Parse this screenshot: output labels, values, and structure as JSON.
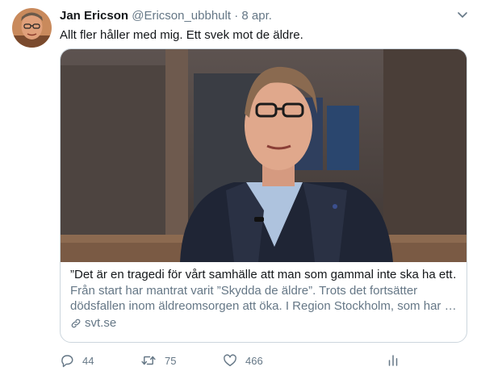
{
  "tweet": {
    "author_name": "Jan Ericson",
    "author_handle": "@Ericson_ubbhult",
    "separator": "·",
    "date": "8 apr.",
    "text": "Allt fler håller med mig. Ett svek mot de äldre.",
    "menu_icon": "chevron-down-icon"
  },
  "card": {
    "title": "”Det är en tragedi för vårt samhälle att man som gammal inte ska ha ett…",
    "description_line1": "Från start har mantrat varit ”Skydda de äldre”. Trots det fortsätter",
    "description_line2": "dödsfallen inom äldreomsorgen att öka. I Region Stockholm, som har …",
    "domain": "svt.se",
    "link_icon": "link-icon"
  },
  "actions": {
    "reply_count": "44",
    "retweet_count": "75",
    "like_count": "466",
    "reply_icon": "reply-icon",
    "retweet_icon": "retweet-icon",
    "like_icon": "heart-icon",
    "analytics_icon": "analytics-icon"
  },
  "colors": {
    "text": "#14171a",
    "secondary": "#657786",
    "border": "#ccd6dd"
  }
}
